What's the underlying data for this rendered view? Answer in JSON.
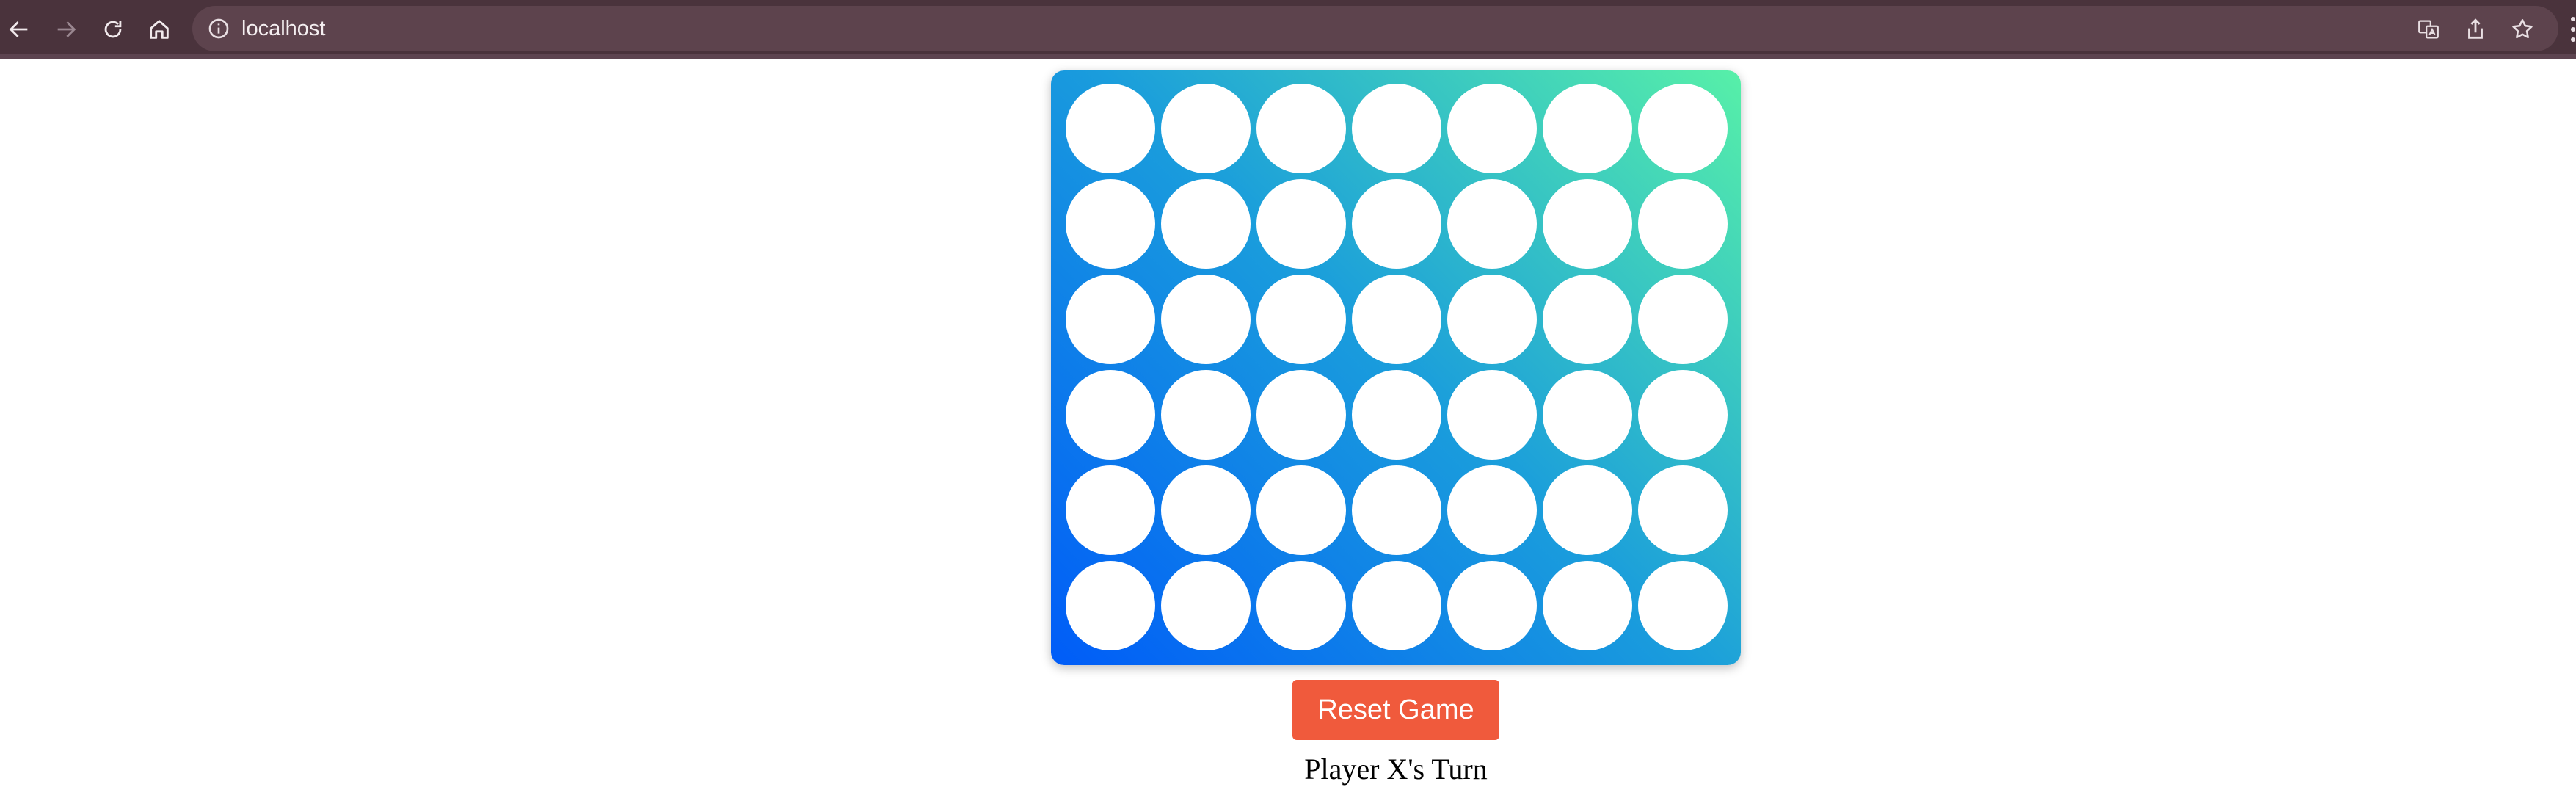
{
  "browser": {
    "url": "localhost",
    "toolbar_color": "#4a333c"
  },
  "game": {
    "rows": 6,
    "columns": 7,
    "board": [
      [
        "",
        "",
        "",
        "",
        "",
        "",
        ""
      ],
      [
        "",
        "",
        "",
        "",
        "",
        "",
        ""
      ],
      [
        "",
        "",
        "",
        "",
        "",
        "",
        ""
      ],
      [
        "",
        "",
        "",
        "",
        "",
        "",
        ""
      ],
      [
        "",
        "",
        "",
        "",
        "",
        "",
        ""
      ],
      [
        "",
        "",
        "",
        "",
        "",
        "",
        ""
      ]
    ],
    "reset_label": "Reset Game",
    "status": "Player X's Turn",
    "colors": {
      "gradient_start": "#005cf8",
      "gradient_end": "#57f0a8",
      "empty_cell": "#ffffff",
      "reset_button": "#f05a3c"
    }
  }
}
